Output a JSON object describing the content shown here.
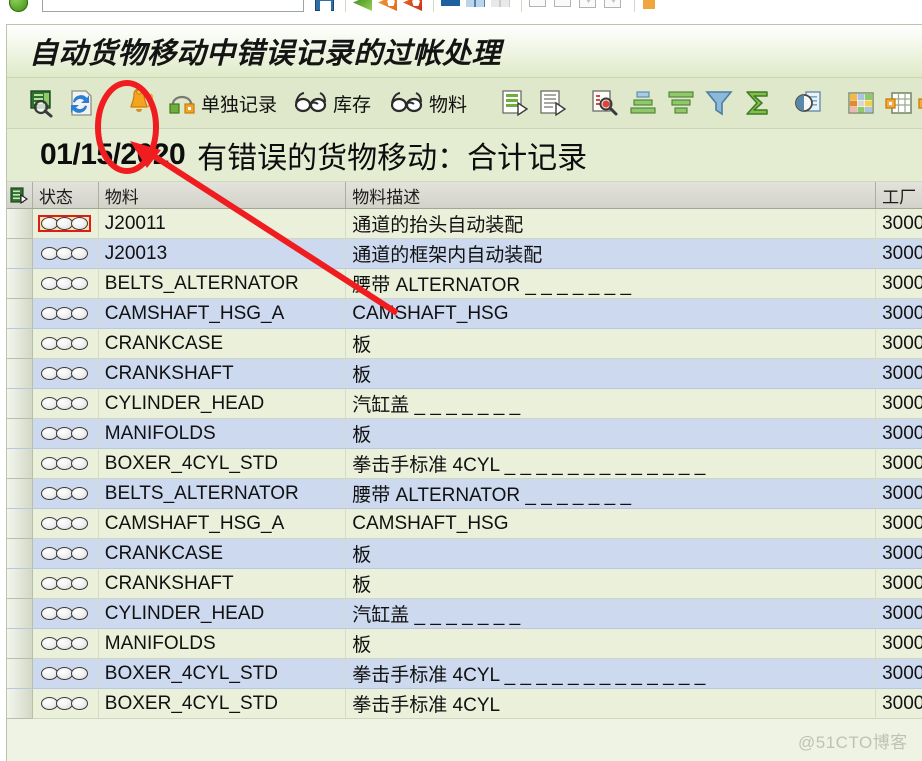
{
  "window": {
    "screen_title": "自动货物移动中错误记录的过帐处理"
  },
  "system_toolbar": {
    "command_field_value": "",
    "items": [
      {
        "name": "enter-icon",
        "label": ""
      },
      {
        "name": "save-icon",
        "label": ""
      },
      {
        "name": "back-icon",
        "label": ""
      },
      {
        "name": "exit-icon",
        "label": ""
      },
      {
        "name": "cancel-icon",
        "label": ""
      },
      {
        "name": "print-icon",
        "label": ""
      },
      {
        "name": "find-icon",
        "label": ""
      },
      {
        "name": "find-next-icon",
        "label": ""
      },
      {
        "name": "first-page-icon",
        "label": ""
      },
      {
        "name": "previous-page-icon",
        "label": ""
      },
      {
        "name": "next-page-icon",
        "label": ""
      },
      {
        "name": "last-page-icon",
        "label": ""
      }
    ]
  },
  "app_toolbar": {
    "buttons": [
      {
        "name": "execute-button",
        "icon": "execute-icon",
        "label": ""
      },
      {
        "name": "refresh-button",
        "icon": "refresh-icon",
        "label": ""
      },
      {
        "name": "post-button",
        "icon": "bell-icon",
        "label": ""
      },
      {
        "name": "single-record-button",
        "icon": "lock-arrow-icon",
        "label": "单独记录"
      },
      {
        "name": "stock-button",
        "icon": "glasses-icon",
        "label": "库存"
      },
      {
        "name": "material-button",
        "icon": "glasses-icon",
        "label": "物料"
      },
      {
        "name": "detail-button",
        "icon": "detail-list-icon",
        "label": ""
      },
      {
        "name": "display-variant-button",
        "icon": "display-list-icon",
        "label": ""
      },
      {
        "name": "find-button",
        "icon": "find-doc-icon",
        "label": ""
      },
      {
        "name": "sort-ascending-button",
        "icon": "sort-asc-icon",
        "label": ""
      },
      {
        "name": "sort-descending-button",
        "icon": "sort-desc-icon",
        "label": ""
      },
      {
        "name": "filter-button",
        "icon": "funnel-icon",
        "label": ""
      },
      {
        "name": "total-button",
        "icon": "sigma-icon",
        "label": ""
      },
      {
        "name": "print-preview-button",
        "icon": "print-preview-icon",
        "label": ""
      },
      {
        "name": "layout-button",
        "icon": "grid-color-icon",
        "label": ""
      },
      {
        "name": "export-button",
        "icon": "grid-export-icon",
        "label": ""
      }
    ]
  },
  "report": {
    "date": "01/15/2020",
    "heading": "有错误的货物移动：合计记录"
  },
  "grid": {
    "columns": [
      {
        "key": "select",
        "label": ""
      },
      {
        "key": "status",
        "label": "状态"
      },
      {
        "key": "matnr",
        "label": "物料"
      },
      {
        "key": "maktx",
        "label": "物料描述"
      },
      {
        "key": "werks",
        "label": "工厂"
      }
    ],
    "rows": [
      {
        "status": "lights",
        "matnr": "J20011",
        "maktx": "通道的抬头自动装配",
        "werks": "3000",
        "selected": true
      },
      {
        "status": "lights",
        "matnr": "J20013",
        "maktx": "通道的框架内自动装配",
        "werks": "3000",
        "selected": false
      },
      {
        "status": "lights",
        "matnr": "BELTS_ALTERNATOR",
        "maktx": "腰带 ALTERNATOR _ _ _ _ _ _ _",
        "werks": "3000",
        "selected": false
      },
      {
        "status": "lights",
        "matnr": "CAMSHAFT_HSG_A",
        "maktx": "CAMSHAFT_HSG",
        "werks": "3000",
        "selected": false
      },
      {
        "status": "lights",
        "matnr": "CRANKCASE",
        "maktx": "板",
        "werks": "3000",
        "selected": false
      },
      {
        "status": "lights",
        "matnr": "CRANKSHAFT",
        "maktx": "板",
        "werks": "3000",
        "selected": false
      },
      {
        "status": "lights",
        "matnr": "CYLINDER_HEAD",
        "maktx": "汽缸盖 _ _ _ _ _ _ _",
        "werks": "3000",
        "selected": false
      },
      {
        "status": "lights",
        "matnr": "MANIFOLDS",
        "maktx": "板",
        "werks": "3000",
        "selected": false
      },
      {
        "status": "lights",
        "matnr": "BOXER_4CYL_STD",
        "maktx": "拳击手标准 4CYL _ _ _ _ _ _ _ _ _ _ _ _ _",
        "werks": "3000",
        "selected": false
      },
      {
        "status": "lights",
        "matnr": "BELTS_ALTERNATOR",
        "maktx": "腰带 ALTERNATOR _ _ _ _ _ _ _",
        "werks": "3000",
        "selected": false
      },
      {
        "status": "lights",
        "matnr": "CAMSHAFT_HSG_A",
        "maktx": "CAMSHAFT_HSG",
        "werks": "3000",
        "selected": false
      },
      {
        "status": "lights",
        "matnr": "CRANKCASE",
        "maktx": "板",
        "werks": "3000",
        "selected": false
      },
      {
        "status": "lights",
        "matnr": "CRANKSHAFT",
        "maktx": "板",
        "werks": "3000",
        "selected": false
      },
      {
        "status": "lights",
        "matnr": "CYLINDER_HEAD",
        "maktx": "汽缸盖 _ _ _ _ _ _ _",
        "werks": "3000",
        "selected": false
      },
      {
        "status": "lights",
        "matnr": "MANIFOLDS",
        "maktx": "板",
        "werks": "3000",
        "selected": false
      },
      {
        "status": "lights",
        "matnr": "BOXER_4CYL_STD",
        "maktx": "拳击手标准 4CYL _ _ _ _ _ _ _ _ _ _ _ _ _",
        "werks": "3000",
        "selected": false
      },
      {
        "status": "lights",
        "matnr": "BOXER_4CYL_STD",
        "maktx": "拳击手标准 4CYL",
        "werks": "3000",
        "selected": false
      }
    ]
  },
  "annotations": {
    "ellipse": {
      "name": "red-ellipse-highlight",
      "color": "#ef1c20"
    },
    "arrow": {
      "name": "red-arrow-pointer",
      "color": "#ef1c20"
    }
  },
  "watermark": {
    "text": "@51CTO博客"
  },
  "colors": {
    "toolbar_bg": "#dfe8ca",
    "report_bg": "#e4ecd2",
    "row_even": "#eaf0da",
    "row_odd": "#ccd9ef",
    "header_grey": "#d8d8d0",
    "selection_yellow": "#fbe9a8",
    "annotation_red": "#ef1c20"
  }
}
